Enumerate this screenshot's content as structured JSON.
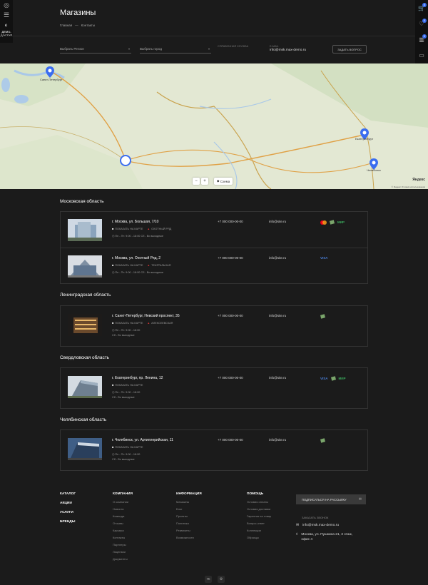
{
  "header": {
    "title": "Магазины",
    "breadcrumbs": [
      "Главная",
      "—",
      "Контакты"
    ]
  },
  "sidebar_left": {
    "demo_label": "ДЕМО-ДОСТУП"
  },
  "sidebar_right": {
    "badges": [
      "0",
      "0",
      "0"
    ]
  },
  "filters": {
    "region_placeholder": "Выбрать Регион",
    "city_placeholder": "Выбрать город",
    "support_label": "СПРАВОЧНАЯ СЛУЖБА",
    "email_label": "E-MAIL",
    "email_value": "info@msk.max-demo.ru",
    "ask_button": "ЗАДАТЬ ВОПРОС"
  },
  "map": {
    "cities": [
      "Санкт-Петербург",
      "Екатеринбург",
      "Челябинск"
    ],
    "zoom_in": "+",
    "zoom_out": "−",
    "scheme_label": "Схема",
    "logo": "Яндекс",
    "copyright": "© Яндекс Условия использования"
  },
  "regions": [
    {
      "name": "Московская область",
      "stores": [
        {
          "address": "г. Москва, ул. Большая, 7/10",
          "show_map": "ПОКАЗАТЬ НА КАРТЕ",
          "metro": "ОХОТНЫЙ РЯД",
          "hours": "Пн - Пт: 9:00 - 18:00 Сб - Вс выходные",
          "hours2": "",
          "phone": "+7 000 000-00-00",
          "email": "info@site.ru",
          "payments": [
            "mastercard-icon",
            "cash-icon",
            "МИР"
          ]
        },
        {
          "address": "г. Москва, ул. Охотный Ряд, 2",
          "show_map": "ПОКАЗАТЬ НА КАРТЕ",
          "metro": "ТЕАТРАЛЬНАЯ",
          "hours": "Пн - Пт: 9:00 - 18:00 Сб - Вс выходные",
          "hours2": "",
          "phone": "+7 000 000-00-00",
          "email": "info@site.ru",
          "payments": [
            "VISA"
          ]
        }
      ]
    },
    {
      "name": "Ленинградская область",
      "stores": [
        {
          "address": "г. Санкт-Петербург, Невский проспект, 35",
          "show_map": "ПОКАЗАТЬ НА КАРТЕ",
          "metro": "АЛЕКСЕЕВСКАЯ",
          "hours": "Пн - Пт: 9:00 - 18:00",
          "hours2": "Сб - Вс выходные",
          "phone": "+7 000 000-00-00",
          "email": "info@site.ru",
          "payments": [
            "cash-icon"
          ]
        }
      ]
    },
    {
      "name": "Свердловская область",
      "stores": [
        {
          "address": "г. Екатеринбург, пр. Ленина, 12",
          "show_map": "ПОКАЗАТЬ НА КАРТЕ",
          "metro": "",
          "hours": "Пн - Пт: 9:00 - 18:00",
          "hours2": "Сб - Вс выходные",
          "phone": "+7 000 000-00-00",
          "email": "info@site.ru",
          "payments": [
            "VISA",
            "cash-icon",
            "МИР"
          ]
        }
      ]
    },
    {
      "name": "Челябинская область",
      "stores": [
        {
          "address": "г. Челябинск, ул. Артиллерийская, 11",
          "show_map": "ПОКАЗАТЬ НА КАРТЕ",
          "metro": "",
          "hours": "Пн - Пт: 9:00 - 18:00",
          "hours2": "Сб - Вс выходные",
          "phone": "+7 000 000-00-00",
          "email": "info@site.ru",
          "payments": [
            "cash-icon"
          ]
        }
      ]
    }
  ],
  "footer": {
    "main_links": [
      "КАТАЛОГ",
      "АКЦИИ",
      "УСЛУГИ",
      "БРЕНДЫ"
    ],
    "columns": [
      {
        "title": "КОМПАНИЯ",
        "items": [
          "О компании",
          "Новости",
          "Команда",
          "Отзывы",
          "Карьера",
          "Контакты",
          "Партнеры",
          "Лицензии",
          "Документы"
        ]
      },
      {
        "title": "ИНФОРМАЦИЯ",
        "items": [
          "Магазины",
          "Блог",
          "Проекты",
          "Политика",
          "Реквизиты",
          "Возможности"
        ]
      },
      {
        "title": "ПОМОЩЬ",
        "items": [
          "Условия оплаты",
          "Условия доставки",
          "Гарантия на товар",
          "Вопрос-ответ",
          "Коллекции",
          "Образцы"
        ]
      }
    ],
    "subscribe": "ПОДПИСАТЬСЯ НА РАССЫЛКУ",
    "contact_label": "ЗАКАЗАТЬ ЗВОНОК",
    "email": "info@msk.max-demo.ru",
    "address": "Москва, ул. Пушкина 21, 3 этаж, офис 4"
  },
  "colors": {
    "accent": "#3a6df0",
    "background": "#1b1b1b",
    "card_border": "#333333"
  }
}
